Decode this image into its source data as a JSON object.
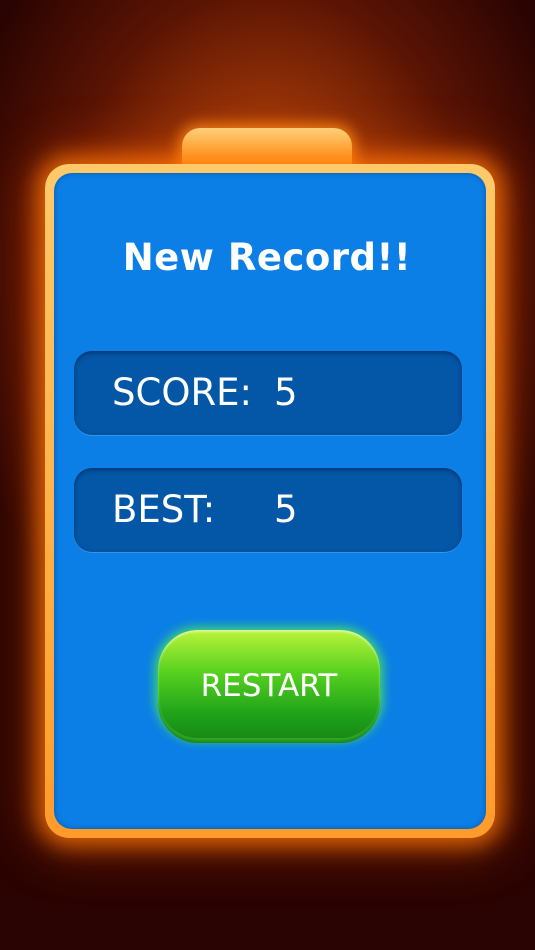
{
  "dialog": {
    "title": "New Record!!",
    "score": {
      "label": "SCORE:",
      "value": "5"
    },
    "best": {
      "label": "BEST:",
      "value": "5"
    },
    "restart_label": "RESTART"
  },
  "colors": {
    "panel": "#0b7fe6",
    "score_box": "#0357a6",
    "frame_glow": "#ff9b2a",
    "button_green": "#1fa21a",
    "text": "#ffffff"
  }
}
